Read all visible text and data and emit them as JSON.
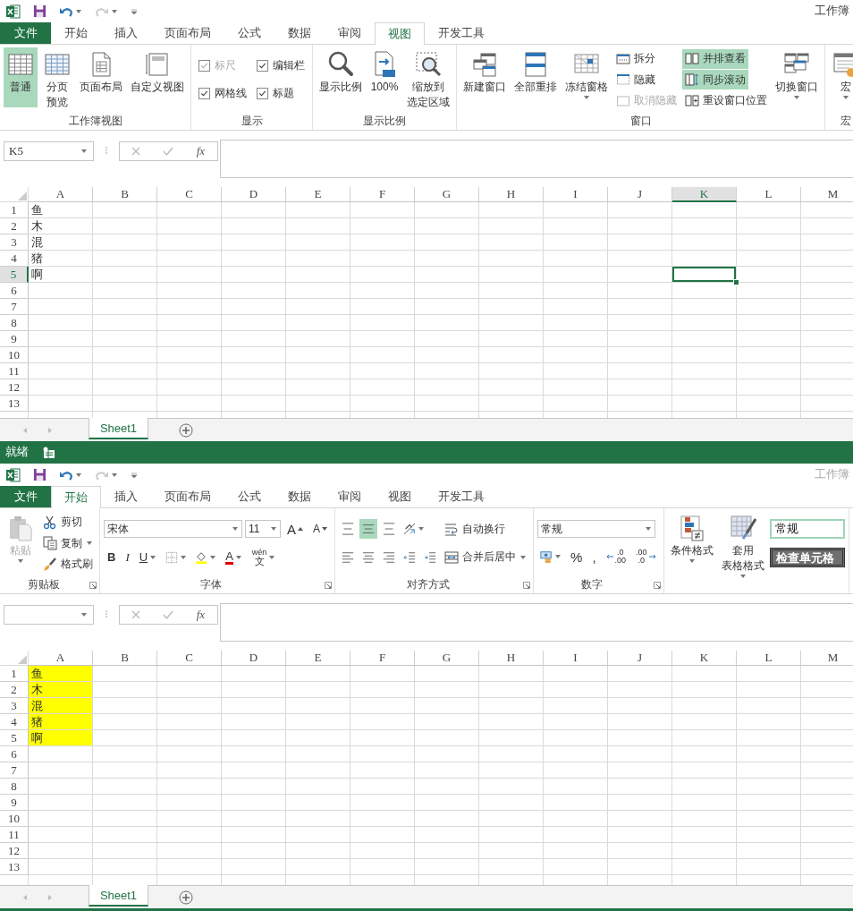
{
  "windows": [
    {
      "title": "工作簿",
      "active": true,
      "tabs": [
        {
          "label": "文件",
          "kind": "file",
          "selected": false
        },
        {
          "label": "开始",
          "kind": "tab",
          "selected": false
        },
        {
          "label": "插入",
          "kind": "tab",
          "selected": false
        },
        {
          "label": "页面布局",
          "kind": "tab",
          "selected": false
        },
        {
          "label": "公式",
          "kind": "tab",
          "selected": false
        },
        {
          "label": "数据",
          "kind": "tab",
          "selected": false
        },
        {
          "label": "审阅",
          "kind": "tab",
          "selected": false
        },
        {
          "label": "视图",
          "kind": "tab",
          "selected": true
        },
        {
          "label": "开发工具",
          "kind": "tab",
          "selected": false
        }
      ],
      "ribbon": {
        "groups": [
          {
            "label": "工作簿视图",
            "columns": [
              [
                [
                  {
                    "kind": "large",
                    "label": "普通",
                    "on": true
                  }
                ]
              ],
              [
                [
                  {
                    "kind": "large",
                    "label": [
                      "分页",
                      "预览"
                    ]
                  }
                ]
              ],
              [
                [
                  {
                    "kind": "large",
                    "label": "页面布局"
                  }
                ]
              ],
              [
                [
                  {
                    "kind": "large",
                    "label": "自定义视图"
                  }
                ]
              ]
            ]
          },
          {
            "label": "显示",
            "columns": [
              [
                [
                  {
                    "kind": "check",
                    "label": "标尺",
                    "checked": true,
                    "disabled": true
                  }
                ],
                [
                  {
                    "kind": "check",
                    "label": "网格线",
                    "checked": true
                  }
                ]
              ],
              [
                [
                  {
                    "kind": "check",
                    "label": "编辑栏",
                    "checked": true
                  }
                ],
                [
                  {
                    "kind": "check",
                    "label": "标题",
                    "checked": true
                  }
                ]
              ]
            ]
          },
          {
            "label": "显示比例",
            "columns": [
              [
                [
                  {
                    "kind": "large",
                    "label": "显示比例"
                  }
                ]
              ],
              [
                [
                  {
                    "kind": "large",
                    "label": "100%"
                  }
                ]
              ],
              [
                [
                  {
                    "kind": "large",
                    "label": [
                      "缩放到",
                      "选定区域"
                    ]
                  }
                ]
              ]
            ]
          },
          {
            "label": "窗口",
            "columns": [
              [
                [
                  {
                    "kind": "large",
                    "label": "新建窗口"
                  }
                ]
              ],
              [
                [
                  {
                    "kind": "large",
                    "label": "全部重排"
                  }
                ]
              ],
              [
                [
                  {
                    "kind": "large",
                    "label": "冻结窗格",
                    "dropdown": true
                  }
                ]
              ],
              [
                [
                  {
                    "kind": "small",
                    "label": "拆分"
                  }
                ],
                [
                  {
                    "kind": "small",
                    "label": "隐藏"
                  }
                ],
                [
                  {
                    "kind": "small",
                    "label": "取消隐藏",
                    "disabled": true
                  }
                ]
              ],
              [
                [
                  {
                    "kind": "small",
                    "label": "并排查看",
                    "on": true
                  }
                ],
                [
                  {
                    "kind": "small",
                    "label": "同步滚动",
                    "on": true
                  }
                ],
                [
                  {
                    "kind": "small",
                    "label": "重设窗口位置"
                  }
                ]
              ],
              [
                [
                  {
                    "kind": "large",
                    "label": "切换窗口",
                    "dropdown": true
                  }
                ]
              ]
            ]
          },
          {
            "label": "宏",
            "columns": [
              [
                [
                  {
                    "kind": "large",
                    "label": "宏",
                    "dropdown": true
                  }
                ]
              ]
            ]
          }
        ]
      },
      "formula_bar": {
        "name_box": "K5",
        "function_button": "fx"
      },
      "grid": {
        "columns": [
          {
            "label": "A",
            "selected": false
          },
          {
            "label": "B",
            "selected": false
          },
          {
            "label": "C",
            "selected": false
          },
          {
            "label": "D",
            "selected": false
          },
          {
            "label": "E",
            "selected": false
          },
          {
            "label": "F",
            "selected": false
          },
          {
            "label": "G",
            "selected": false
          },
          {
            "label": "H",
            "selected": false
          },
          {
            "label": "I",
            "selected": false
          },
          {
            "label": "J",
            "selected": false
          },
          {
            "label": "K",
            "selected": true
          },
          {
            "label": "L",
            "selected": false
          },
          {
            "label": "M",
            "selected": false
          }
        ],
        "rows": [
          {
            "header": "1",
            "selected": false,
            "cells": [
              {
                "text": "鱼",
                "highlighted": false
              }
            ]
          },
          {
            "header": "2",
            "selected": false,
            "cells": [
              {
                "text": "木",
                "highlighted": false
              }
            ]
          },
          {
            "header": "3",
            "selected": false,
            "cells": [
              {
                "text": "混",
                "highlighted": false
              }
            ]
          },
          {
            "header": "4",
            "selected": false,
            "cells": [
              {
                "text": "猪",
                "highlighted": false
              }
            ]
          },
          {
            "header": "5",
            "selected": true,
            "cells": [
              {
                "text": "啊",
                "highlighted": false
              }
            ]
          },
          {
            "header": "6",
            "selected": false
          },
          {
            "header": "7",
            "selected": false
          },
          {
            "header": "8",
            "selected": false
          },
          {
            "header": "9",
            "selected": false
          },
          {
            "header": "10",
            "selected": false
          },
          {
            "header": "11",
            "selected": false
          },
          {
            "header": "12",
            "selected": false
          },
          {
            "header": "13",
            "selected": false
          }
        ]
      },
      "sheet_tabs": [
        {
          "label": "Sheet1",
          "selected": true
        }
      ],
      "status_bar": {
        "text": "就绪"
      }
    },
    {
      "title": "工作簿",
      "active": false,
      "tabs": [
        {
          "label": "文件",
          "kind": "file",
          "selected": false
        },
        {
          "label": "开始",
          "kind": "tab",
          "selected": true
        },
        {
          "label": "插入",
          "kind": "tab",
          "selected": false
        },
        {
          "label": "页面布局",
          "kind": "tab",
          "selected": false
        },
        {
          "label": "公式",
          "kind": "tab",
          "selected": false
        },
        {
          "label": "数据",
          "kind": "tab",
          "selected": false
        },
        {
          "label": "审阅",
          "kind": "tab",
          "selected": false
        },
        {
          "label": "视图",
          "kind": "tab",
          "selected": false
        },
        {
          "label": "开发工具",
          "kind": "tab",
          "selected": false
        }
      ],
      "ribbon": {
        "groups": [
          {
            "label": "剪贴板",
            "launcher": true,
            "columns": [
              [
                [
                  {
                    "kind": "large",
                    "label": "粘贴",
                    "disabled": true,
                    "dropdown": true
                  }
                ]
              ],
              [
                [
                  {
                    "kind": "small",
                    "label": "剪切"
                  }
                ],
                [
                  {
                    "kind": "small",
                    "label": "复制",
                    "dropdown": true
                  }
                ],
                [
                  {
                    "kind": "small",
                    "label": "格式刷"
                  }
                ]
              ]
            ]
          },
          {
            "label": "字体",
            "launcher": true,
            "columns": [
              [
                [
                  {
                    "kind": "field",
                    "value": "宋体"
                  },
                  {
                    "kind": "field",
                    "value": "11"
                  },
                  {
                    "kind": "grow",
                    "label": "A"
                  },
                  {
                    "kind": "shrink",
                    "label": "A"
                  }
                ],
                [
                  {
                    "kind": "bold",
                    "label": "B"
                  },
                  {
                    "kind": "italic",
                    "label": "I"
                  },
                  {
                    "kind": "underline",
                    "label": "U",
                    "dropdown": true
                  },
                  {
                    "kind": "iconbtn",
                    "dropdown": true
                  },
                  {
                    "kind": "iconbtn",
                    "dropdown": true
                  },
                  {
                    "kind": "fontcolor",
                    "label": "A",
                    "dropdown": true
                  },
                  {
                    "kind": "phonetic",
                    "label": [
                      "wén",
                      "文"
                    ],
                    "dropdown": true
                  }
                ]
              ]
            ]
          },
          {
            "label": "对齐方式",
            "launcher": true,
            "columns": [
              [
                [
                  {
                    "kind": "iconbtn"
                  },
                  {
                    "kind": "iconbtn",
                    "on": true
                  },
                  {
                    "kind": "iconbtn"
                  }
                ],
                [
                  {
                    "kind": "iconbtn"
                  },
                  {
                    "kind": "iconbtn"
                  },
                  {
                    "kind": "iconbtn"
                  }
                ]
              ],
              [
                [
                  {
                    "kind": "iconbtn",
                    "dropdown": true
                  }
                ],
                [
                  {
                    "kind": "iconbtn"
                  },
                  {
                    "kind": "iconbtn"
                  }
                ]
              ],
              [
                [
                  {
                    "kind": "small",
                    "label": "自动换行"
                  }
                ],
                [
                  {
                    "kind": "small",
                    "label": "合并后居中",
                    "dropdown": true
                  }
                ]
              ]
            ]
          },
          {
            "label": "数字",
            "launcher": true,
            "columns": [
              [
                [
                  {
                    "kind": "field",
                    "value": "常规"
                  }
                ],
                [
                  {
                    "kind": "iconbtn",
                    "dropdown": true
                  },
                  {
                    "kind": "plain",
                    "label": "%"
                  },
                  {
                    "kind": "plain",
                    "label": ","
                  },
                  {
                    "kind": "decinc",
                    "label": [
                      ".0",
                      ".00"
                    ]
                  },
                  {
                    "kind": "decdec",
                    "label": [
                      ".00",
                      ".0"
                    ]
                  }
                ]
              ]
            ]
          },
          {
            "columns": [
              [
                [
                  {
                    "kind": "large",
                    "label": "条件格式",
                    "dropdown": true
                  }
                ]
              ],
              [
                [
                  {
                    "kind": "large",
                    "label": [
                      "套用",
                      "表格格式"
                    ],
                    "dropdown": true
                  }
                ]
              ],
              [
                [
                  {
                    "kind": "plaincell",
                    "label": "常规"
                  }
                ],
                [
                  {
                    "kind": "checkcell",
                    "label": "检查单元格"
                  }
                ]
              ]
            ]
          }
        ]
      },
      "formula_bar": {
        "function_button": "fx"
      },
      "grid": {
        "columns": [
          {
            "label": "A",
            "selected": false
          },
          {
            "label": "B",
            "selected": false
          },
          {
            "label": "C",
            "selected": false
          },
          {
            "label": "D",
            "selected": false
          },
          {
            "label": "E",
            "selected": false
          },
          {
            "label": "F",
            "selected": false
          },
          {
            "label": "G",
            "selected": false
          },
          {
            "label": "H",
            "selected": false
          },
          {
            "label": "I",
            "selected": false
          },
          {
            "label": "J",
            "selected": false
          },
          {
            "label": "K",
            "selected": false
          },
          {
            "label": "L",
            "selected": false
          },
          {
            "label": "M",
            "selected": false
          }
        ],
        "rows": [
          {
            "header": "1",
            "selected": false,
            "cells": [
              {
                "text": "鱼",
                "highlighted": true
              }
            ]
          },
          {
            "header": "2",
            "selected": false,
            "cells": [
              {
                "text": "木",
                "highlighted": true
              }
            ]
          },
          {
            "header": "3",
            "selected": false,
            "cells": [
              {
                "text": "混",
                "highlighted": true
              }
            ]
          },
          {
            "header": "4",
            "selected": false,
            "cells": [
              {
                "text": "猪",
                "highlighted": true
              }
            ]
          },
          {
            "header": "5",
            "selected": false,
            "cells": [
              {
                "text": "啊",
                "highlighted": true
              }
            ]
          },
          {
            "header": "6",
            "selected": false
          },
          {
            "header": "7",
            "selected": false
          },
          {
            "header": "8",
            "selected": false
          },
          {
            "header": "9",
            "selected": false
          },
          {
            "header": "10",
            "selected": false
          },
          {
            "header": "11",
            "selected": false
          },
          {
            "header": "12",
            "selected": false
          },
          {
            "header": "13",
            "selected": false
          }
        ]
      },
      "sheet_tabs": [
        {
          "label": "Sheet1",
          "selected": true
        }
      ]
    }
  ]
}
